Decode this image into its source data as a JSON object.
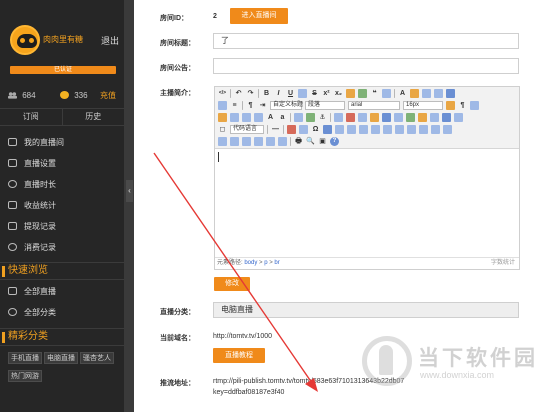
{
  "sidebar": {
    "username": "肉肉里有糖",
    "logout": "退出",
    "level_badge": "已认证",
    "stats": {
      "fans_count": "684",
      "coins_count": "336",
      "charge_label": "充值"
    },
    "tabs": [
      "订阅",
      "历史"
    ],
    "menu_items": [
      {
        "label": "我的直播间",
        "icon": "screen-icon"
      },
      {
        "label": "直播设置",
        "icon": "sliders-icon"
      },
      {
        "label": "直播时长",
        "icon": "clock-icon"
      },
      {
        "label": "收益统计",
        "icon": "stats-icon"
      },
      {
        "label": "提现记录",
        "icon": "withdraw-icon"
      },
      {
        "label": "消费记录",
        "icon": "yen-icon"
      }
    ],
    "quick_browse": {
      "heading": "快速浏览",
      "items": [
        {
          "label": "全部直播",
          "icon": "tv-icon"
        },
        {
          "label": "全部分类",
          "icon": "grid-icon"
        }
      ]
    },
    "categories": {
      "heading": "精彩分类",
      "row1": [
        "手机直播",
        "电脑直播",
        "骚杏艺人"
      ],
      "row2": [
        "热门网游"
      ]
    }
  },
  "form": {
    "room_id": {
      "label": "房间ID：",
      "value": "2",
      "enter_button": "进入直播间"
    },
    "room_title": {
      "label": "房间标题：",
      "value": "了"
    },
    "room_notice": {
      "label": "房间公告：",
      "value": ""
    },
    "host_intro": {
      "label": "主播简介："
    },
    "edit_button": "修改",
    "live_category": {
      "label": "直播分类：",
      "value": "电脑直播"
    },
    "current_domain": {
      "label": "当前域名：",
      "value": "http://tomtv.tv/1000"
    },
    "tutorial_button": "直播教程",
    "push_address": {
      "label": "推流地址：",
      "line1": "rtmp://pili-publish.tomtv.tv/tomtv/583e63f7101313643b22db07",
      "line2": "key=ddfbaf08187e3f40"
    }
  },
  "editor": {
    "toolbar_selects": {
      "custom_title": "自定义标题",
      "paragraph": "段落",
      "font": "arial",
      "size": "16px",
      "code_lang": "代码语言"
    },
    "path_label": "元素路径:",
    "path": [
      "body",
      "p",
      "br"
    ],
    "word_count": "字数统计"
  },
  "watermark": {
    "title": "当下软件园",
    "url": "www.downxia.com"
  },
  "colors": {
    "accent": "#f08a1a",
    "sidebar_bg": "#262626",
    "annotation_arrow": "#e53935"
  }
}
